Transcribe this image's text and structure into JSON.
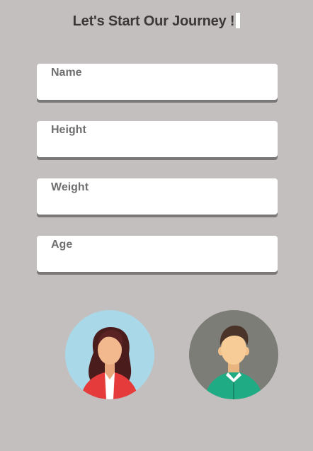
{
  "title": "Let's Start Our Journey !",
  "fields": [
    {
      "key": "name",
      "label": "Name"
    },
    {
      "key": "height",
      "label": "Height"
    },
    {
      "key": "weight",
      "label": "Weight"
    },
    {
      "key": "age",
      "label": "Age"
    }
  ],
  "avatars": [
    {
      "key": "female",
      "icon": "female-avatar-icon",
      "background": "#a9d8e9"
    },
    {
      "key": "male",
      "icon": "male-avatar-icon",
      "background": "#7c7d76"
    }
  ],
  "colors": {
    "background": "#c3bfbf",
    "title": "#3a3838",
    "field_bg": "#ffffff",
    "field_label": "#6f6f6f",
    "field_shadow": "#7a7777"
  }
}
